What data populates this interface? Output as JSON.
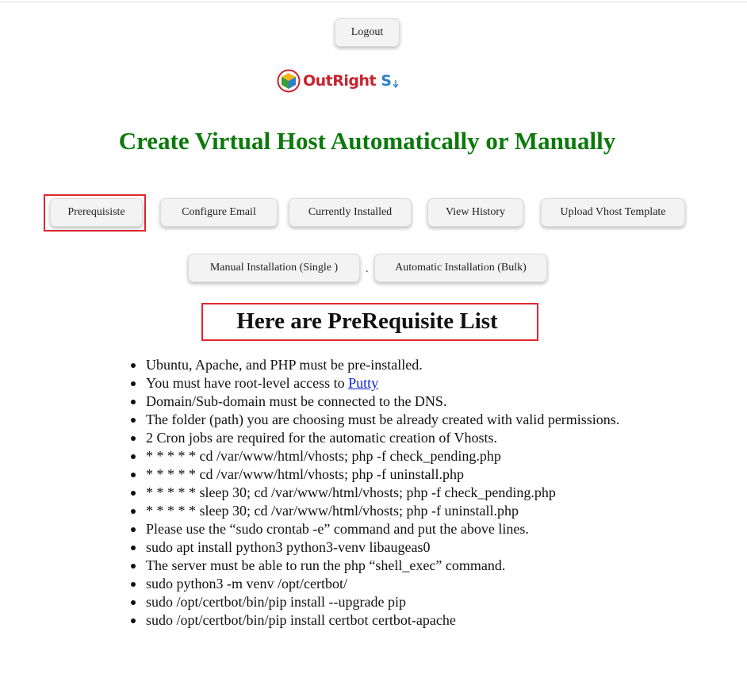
{
  "header": {
    "logout_label": "Logout",
    "logo": {
      "text_main": "OutRight",
      "text_s": "S",
      "icon": "cube-logo-icon"
    }
  },
  "page": {
    "title": "Create Virtual Host Automatically or Manually"
  },
  "nav": {
    "tabs": [
      {
        "label": "Prerequisiste"
      },
      {
        "label": "Configure Email"
      },
      {
        "label": "Currently Installed"
      },
      {
        "label": "View History"
      },
      {
        "label": "Upload Vhost Template"
      },
      {
        "label": "Manual Installation (Single )"
      },
      {
        "label": "Automatic Installation (Bulk)"
      }
    ],
    "separator": ".",
    "selected": "Prerequisiste"
  },
  "prerequisites": {
    "heading": "Here are PreRequisite List",
    "items": [
      "Ubuntu, Apache, and PHP must be pre-installed.",
      "You must have root-level access to",
      "Domain/Sub-domain must be connected to the DNS.",
      "The folder (path) you are choosing must be already created with valid permissions.",
      "2 Cron jobs are required for the automatic creation of Vhosts.",
      "* * * * * cd /var/www/html/vhosts; php -f check_pending.php",
      "* * * * * cd /var/www/html/vhosts; php -f uninstall.php",
      "* * * * * sleep 30; cd /var/www/html/vhosts; php -f check_pending.php",
      "* * * * * sleep 30; cd /var/www/html/vhosts; php -f uninstall.php",
      "Please use the “sudo crontab -e” command and put the above lines.",
      "sudo apt install python3 python3-venv libaugeas0",
      "The server must be able to run the php “shell_exec” command.",
      "sudo python3 -m venv /opt/certbot/",
      "sudo /opt/certbot/bin/pip install --upgrade pip",
      "sudo /opt/certbot/bin/pip install certbot certbot-apache"
    ],
    "putty_link": "Putty"
  },
  "colors": {
    "title_green": "#0b7a0b",
    "highlight_red": "#e0262f",
    "link_blue": "#0b1fd6",
    "logo_red": "#c8232c",
    "logo_blue": "#2f7fc8"
  }
}
